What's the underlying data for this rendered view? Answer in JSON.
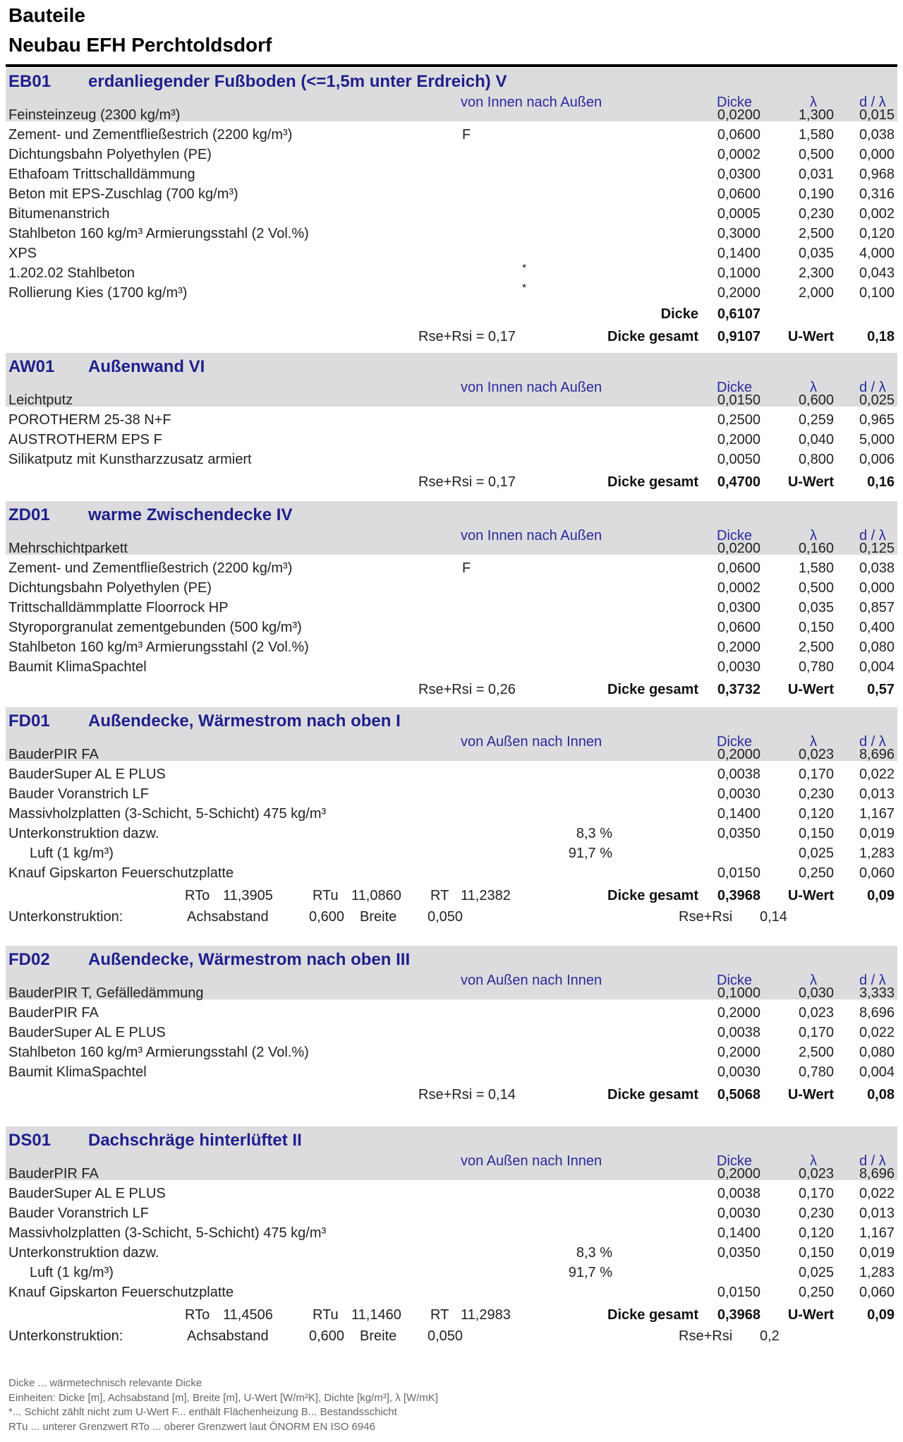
{
  "header": {
    "title": "Bauteile",
    "subtitle": "Neubau EFH Perchtoldsdorf"
  },
  "columns": {
    "dicke": "Dicke",
    "lambda": "λ",
    "d_lambda": "d / λ"
  },
  "labels": {
    "dicke_gesamt": "Dicke gesamt",
    "u_wert": "U-Wert",
    "dicke": "Dicke",
    "unterkonstruktion": "Unterkonstruktion:",
    "achsabstand": "Achsabstand",
    "breite": "Breite",
    "rse_rsi": "Rse+Rsi",
    "rto": "RTo",
    "rtu": "RTu",
    "rt": "RT"
  },
  "sections": [
    {
      "code": "EB01",
      "name": "erdanliegender Fußboden (<=1,5m unter Erdreich) V",
      "direction": "von Innen nach Außen",
      "layers": [
        {
          "name": "Feinsteinzeug (2300 kg/m³)",
          "d": "0,0200",
          "l": "1,300",
          "dl": "0,015"
        },
        {
          "name": "Zement- und Zementfließestrich (2200 kg/m³)",
          "flag": "F",
          "d": "0,0600",
          "l": "1,580",
          "dl": "0,038"
        },
        {
          "name": "Dichtungsbahn Polyethylen (PE)",
          "d": "0,0002",
          "l": "0,500",
          "dl": "0,000"
        },
        {
          "name": "Ethafoam Trittschalldämmung",
          "d": "0,0300",
          "l": "0,031",
          "dl": "0,968"
        },
        {
          "name": "Beton mit EPS-Zuschlag (700 kg/m³)",
          "d": "0,0600",
          "l": "0,190",
          "dl": "0,316"
        },
        {
          "name": "Bitumenanstrich",
          "d": "0,0005",
          "l": "0,230",
          "dl": "0,002"
        },
        {
          "name": "Stahlbeton 160 kg/m³ Armierungsstahl (2 Vol.%)",
          "d": "0,3000",
          "l": "2,500",
          "dl": "0,120"
        },
        {
          "name": "XPS",
          "d": "0,1400",
          "l": "0,035",
          "dl": "4,000"
        },
        {
          "name": "1.202.02 Stahlbeton",
          "star": "*",
          "d": "0,1000",
          "l": "2,300",
          "dl": "0,043"
        },
        {
          "name": "Rollierung Kies (1700 kg/m³)",
          "star": "*",
          "d": "0,2000",
          "l": "2,000",
          "dl": "0,100"
        }
      ],
      "dicke_relevant": "0,6107",
      "rse_rsi": "Rse+Rsi = 0,17",
      "dicke_gesamt": "0,9107",
      "u_wert": "0,18"
    },
    {
      "code": "AW01",
      "name": "Außenwand VI",
      "direction": "von Innen nach Außen",
      "layers": [
        {
          "name": "Leichtputz",
          "d": "0,0150",
          "l": "0,600",
          "dl": "0,025"
        },
        {
          "name": "POROTHERM 25-38 N+F",
          "d": "0,2500",
          "l": "0,259",
          "dl": "0,965"
        },
        {
          "name": "AUSTROTHERM EPS F",
          "d": "0,2000",
          "l": "0,040",
          "dl": "5,000"
        },
        {
          "name": "Silikatputz mit Kunstharzzusatz armiert",
          "d": "0,0050",
          "l": "0,800",
          "dl": "0,006"
        }
      ],
      "rse_rsi": "Rse+Rsi = 0,17",
      "dicke_gesamt": "0,4700",
      "u_wert": "0,16"
    },
    {
      "code": "ZD01",
      "name": "warme Zwischendecke IV",
      "direction": "von Innen nach Außen",
      "layers": [
        {
          "name": "Mehrschichtparkett",
          "d": "0,0200",
          "l": "0,160",
          "dl": "0,125"
        },
        {
          "name": "Zement- und Zementfließestrich (2200 kg/m³)",
          "flag": "F",
          "d": "0,0600",
          "l": "1,580",
          "dl": "0,038"
        },
        {
          "name": "Dichtungsbahn Polyethylen (PE)",
          "d": "0,0002",
          "l": "0,500",
          "dl": "0,000"
        },
        {
          "name": "Trittschalldämmplatte Floorrock HP",
          "d": "0,0300",
          "l": "0,035",
          "dl": "0,857"
        },
        {
          "name": "Styroporgranulat zementgebunden (500 kg/m³)",
          "d": "0,0600",
          "l": "0,150",
          "dl": "0,400"
        },
        {
          "name": "Stahlbeton 160 kg/m³ Armierungsstahl (2 Vol.%)",
          "d": "0,2000",
          "l": "2,500",
          "dl": "0,080"
        },
        {
          "name": "Baumit KlimaSpachtel",
          "d": "0,0030",
          "l": "0,780",
          "dl": "0,004"
        }
      ],
      "rse_rsi": "Rse+Rsi = 0,26",
      "dicke_gesamt": "0,3732",
      "u_wert": "0,57"
    },
    {
      "code": "FD01",
      "name": "Außendecke, Wärmestrom nach oben I",
      "direction": "von Außen nach Innen",
      "layers": [
        {
          "name": "BauderPIR FA",
          "d": "0,2000",
          "l": "0,023",
          "dl": "8,696"
        },
        {
          "name": "BauderSuper AL E PLUS",
          "d": "0,0038",
          "l": "0,170",
          "dl": "0,022"
        },
        {
          "name": "Bauder Voranstrich LF",
          "d": "0,0030",
          "l": "0,230",
          "dl": "0,013"
        },
        {
          "name": "Massivholzplatten (3-Schicht, 5-Schicht) 475 kg/m³",
          "d": "0,1400",
          "l": "0,120",
          "dl": "1,167"
        },
        {
          "name": "Unterkonstruktion dazw.",
          "pct": "8,3 %",
          "d": "0,0350",
          "l": "0,150",
          "dl": "0,019"
        },
        {
          "name": "Luft (1 kg/m³)",
          "indent": true,
          "pct": "91,7 %",
          "d": "",
          "l": "0,025",
          "dl": "1,283"
        },
        {
          "name": "Knauf Gipskarton Feuerschutzplatte",
          "d": "0,0150",
          "l": "0,250",
          "dl": "0,060"
        }
      ],
      "rto": "11,3905",
      "rtu": "11,0860",
      "rt": "11,2382",
      "dicke_gesamt": "0,3968",
      "u_wert": "0,09",
      "achsabstand": "0,600",
      "breite": "0,050",
      "rse_rsi_val": "0,14"
    },
    {
      "code": "FD02",
      "name": "Außendecke, Wärmestrom nach oben III",
      "direction": "von Außen nach Innen",
      "layers": [
        {
          "name": "BauderPIR T, Gefälledämmung",
          "d": "0,1000",
          "l": "0,030",
          "dl": "3,333"
        },
        {
          "name": "BauderPIR FA",
          "d": "0,2000",
          "l": "0,023",
          "dl": "8,696"
        },
        {
          "name": "BauderSuper AL E PLUS",
          "d": "0,0038",
          "l": "0,170",
          "dl": "0,022"
        },
        {
          "name": "Stahlbeton 160 kg/m³ Armierungsstahl (2 Vol.%)",
          "d": "0,2000",
          "l": "2,500",
          "dl": "0,080"
        },
        {
          "name": "Baumit KlimaSpachtel",
          "d": "0,0030",
          "l": "0,780",
          "dl": "0,004"
        }
      ],
      "rse_rsi": "Rse+Rsi = 0,14",
      "dicke_gesamt": "0,5068",
      "u_wert": "0,08"
    },
    {
      "code": "DS01",
      "name": "Dachschräge hinterlüftet II",
      "direction": "von Außen nach Innen",
      "layers": [
        {
          "name": "BauderPIR FA",
          "d": "0,2000",
          "l": "0,023",
          "dl": "8,696"
        },
        {
          "name": "BauderSuper AL E PLUS",
          "d": "0,0038",
          "l": "0,170",
          "dl": "0,022"
        },
        {
          "name": "Bauder Voranstrich LF",
          "d": "0,0030",
          "l": "0,230",
          "dl": "0,013"
        },
        {
          "name": "Massivholzplatten (3-Schicht, 5-Schicht) 475 kg/m³",
          "d": "0,1400",
          "l": "0,120",
          "dl": "1,167"
        },
        {
          "name": "Unterkonstruktion dazw.",
          "pct": "8,3 %",
          "d": "0,0350",
          "l": "0,150",
          "dl": "0,019"
        },
        {
          "name": "Luft (1 kg/m³)",
          "indent": true,
          "pct": "91,7 %",
          "d": "",
          "l": "0,025",
          "dl": "1,283"
        },
        {
          "name": "Knauf Gipskarton Feuerschutzplatte",
          "d": "0,0150",
          "l": "0,250",
          "dl": "0,060"
        }
      ],
      "rto": "11,4506",
      "rtu": "11,1460",
      "rt": "11,2983",
      "dicke_gesamt": "0,3968",
      "u_wert": "0,09",
      "achsabstand": "0,600",
      "breite": "0,050",
      "rse_rsi_val": "0,2"
    }
  ],
  "notes": [
    "Dicke ... wärmetechnisch relevante Dicke",
    "Einheiten: Dicke [m], Achsabstand [m], Breite [m], U-Wert [W/m²K], Dichte [kg/m³], λ [W/mK]",
    "*... Schicht zählt nicht zum U-Wert    F... enthält Flächenheizung    B... Bestandsschicht",
    "RTu ... unterer Grenzwert RTo ... oberer  Grenzwert laut ÖNORM EN ISO 6946"
  ]
}
